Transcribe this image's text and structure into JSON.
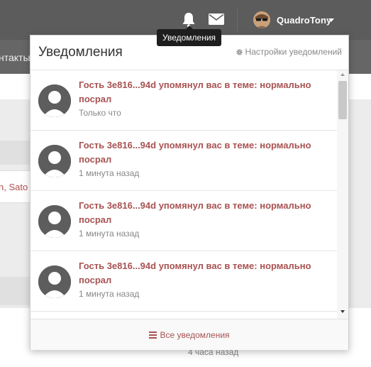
{
  "navbar": {
    "username": "QuadroTony",
    "bell_icon": "bell-icon",
    "envelope_icon": "envelope-icon"
  },
  "tooltip": {
    "text": "Уведомления"
  },
  "background": {
    "subbar_text": "нтакты",
    "side_text": "n, Sato",
    "time_text": "4 часа назад"
  },
  "dropdown": {
    "title": "Уведомления",
    "settings_label": "Настройки уведомлений",
    "footer_label": "Все уведомления",
    "notifications": [
      {
        "text": "Гость 3e816...94d упомянул вас в теме: нормально посрал",
        "time": "Только что"
      },
      {
        "text": "Гость 3e816...94d упомянул вас в теме: нормально посрал",
        "time": "1 минута назад"
      },
      {
        "text": "Гость 3e816...94d упомянул вас в теме: нормально посрал",
        "time": "1 минута назад"
      },
      {
        "text": "Гость 3e816...94d упомянул вас в теме: нормально посрал",
        "time": "1 минута назад"
      }
    ]
  },
  "colors": {
    "navbar": "#5c5c5c",
    "accent": "#a85252",
    "muted": "#888888"
  }
}
